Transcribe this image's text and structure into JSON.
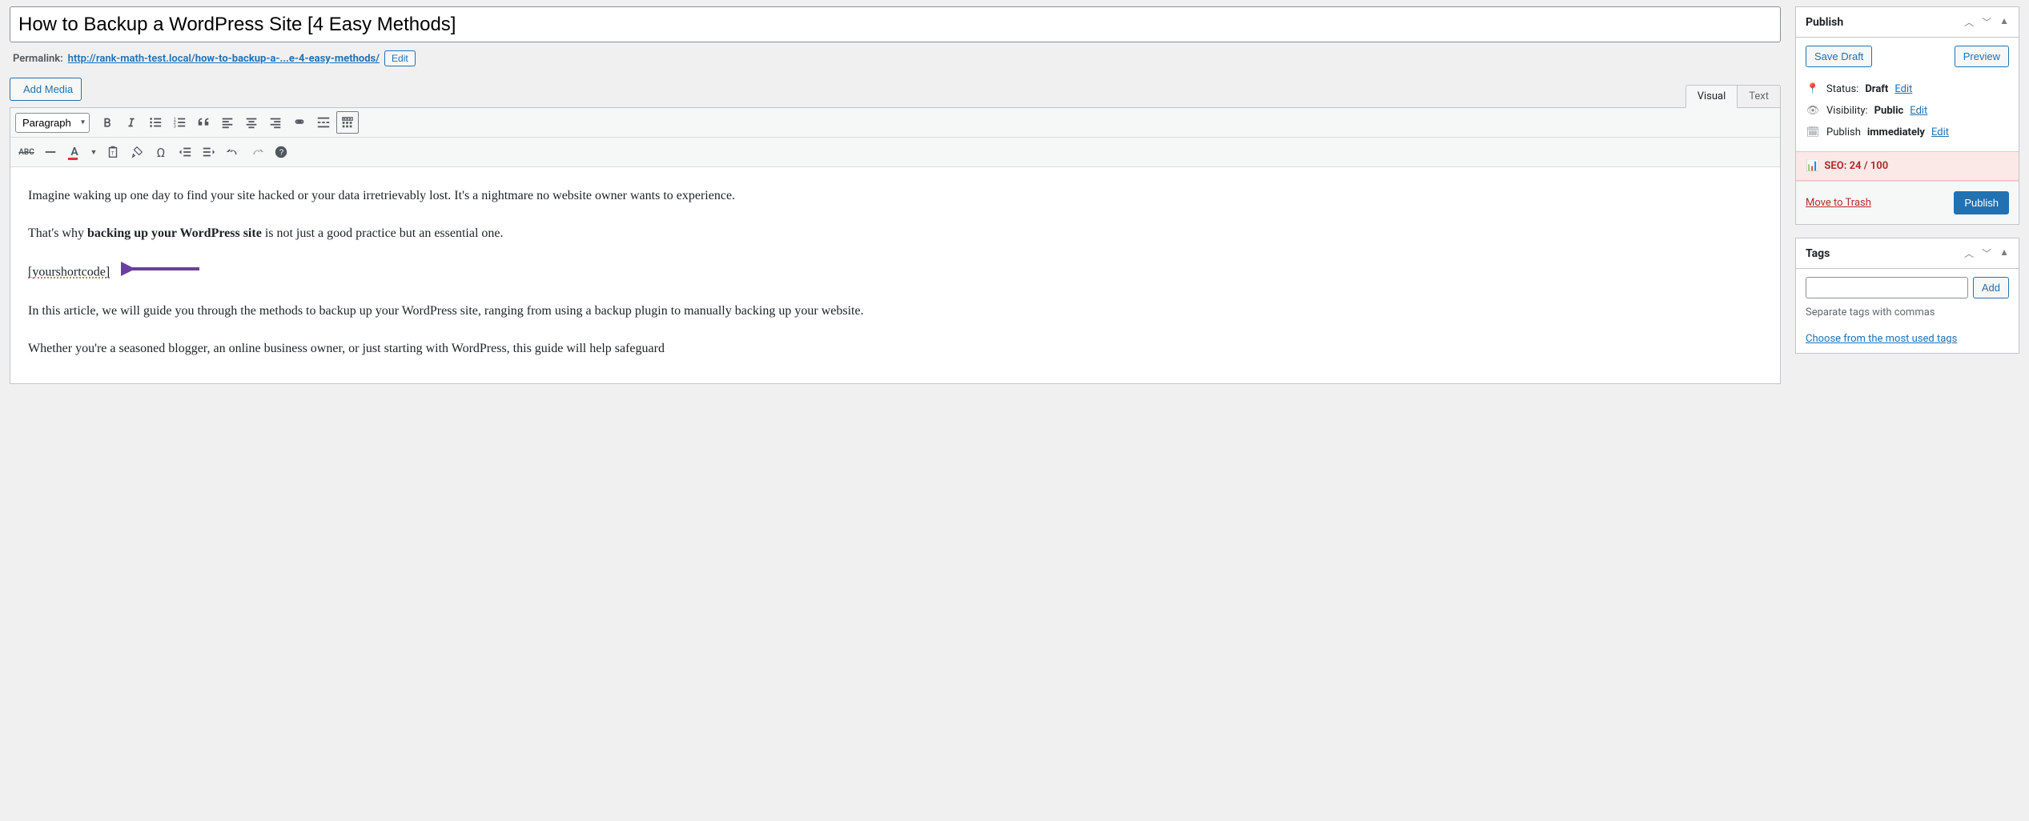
{
  "title": "How to Backup a WordPress Site [4 Easy Methods]",
  "permalink": {
    "label": "Permalink:",
    "base_url": "http://rank-math-test.local/",
    "slug": "how-to-backup-a-...e-4-easy-methods/",
    "edit_label": "Edit"
  },
  "media_button": "Add Media",
  "tabs": {
    "visual": "Visual",
    "text": "Text"
  },
  "toolbar": {
    "format_select": "Paragraph",
    "icons": {
      "bold": "bold-icon",
      "italic": "italic-icon",
      "ul": "bullet-list-icon",
      "ol": "numbered-list-icon",
      "quote": "blockquote-icon",
      "align_left": "align-left-icon",
      "align_center": "align-center-icon",
      "align_right": "align-right-icon",
      "link": "link-icon",
      "more": "read-more-icon",
      "toggle": "toolbar-toggle-icon",
      "abc": "strikethrough-icon",
      "hr": "horizontal-rule-icon",
      "text_color": "text-color-icon",
      "paste": "paste-text-icon",
      "clear": "clear-format-icon",
      "special": "special-char-icon",
      "outdent": "outdent-icon",
      "indent": "indent-icon",
      "undo": "undo-icon",
      "redo": "redo-icon",
      "help": "help-icon"
    }
  },
  "content": {
    "p1": "Imagine waking up one day to find your site hacked or your data irretrievably lost. It's a nightmare no website owner wants to experience.",
    "p2a": "That's why ",
    "p2b": "backing up your WordPress site",
    "p2c": " is not just a good practice but an essential one.",
    "shortcode": "[yourshortcode]",
    "p4": "In this article, we will guide you through the methods to backup up your WordPress site, ranging from using a backup plugin to manually backing up your website.",
    "p5": "Whether you're a seasoned blogger, an online business owner, or just starting with WordPress, this guide will help safeguard"
  },
  "publish": {
    "title": "Publish",
    "save_draft": "Save Draft",
    "preview": "Preview",
    "status_label": "Status:",
    "status_value": "Draft",
    "status_edit": "Edit",
    "visibility_label": "Visibility:",
    "visibility_value": "Public",
    "visibility_edit": "Edit",
    "publish_label": "Publish",
    "publish_value": "immediately",
    "publish_edit": "Edit",
    "seo_label": "SEO: 24 / 100",
    "trash": "Move to Trash",
    "publish_button": "Publish"
  },
  "tags": {
    "title": "Tags",
    "add_button": "Add",
    "hint": "Separate tags with commas",
    "choose_link": "Choose from the most used tags"
  }
}
